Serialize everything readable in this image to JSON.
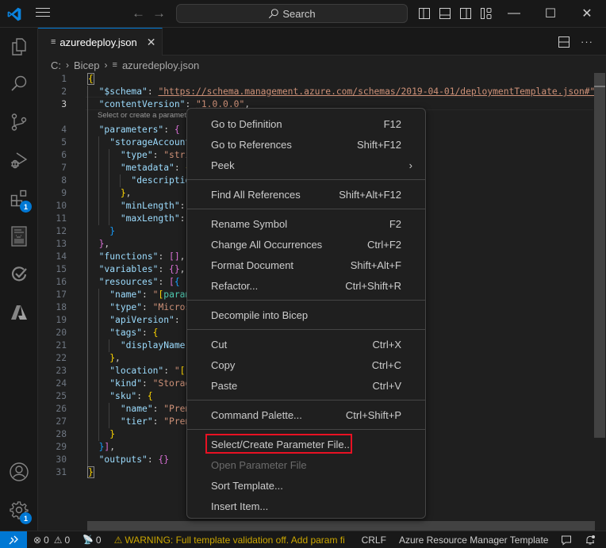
{
  "titlebar": {
    "search_label": "Search",
    "back": "←",
    "forward": "→",
    "minimize": "—",
    "maximize": "☐",
    "close": "✕"
  },
  "activity_bar": {
    "items": [
      {
        "name": "explorer",
        "icon": "files-icon"
      },
      {
        "name": "search",
        "icon": "search-icon"
      },
      {
        "name": "source-control",
        "icon": "source-control-icon"
      },
      {
        "name": "run-debug",
        "icon": "run-debug-icon"
      },
      {
        "name": "extensions",
        "icon": "extensions-icon",
        "badge": "1"
      },
      {
        "name": "document-outline",
        "icon": "document-icon"
      },
      {
        "name": "testing",
        "icon": "testing-icon"
      },
      {
        "name": "azure",
        "icon": "azure-icon"
      }
    ],
    "bottom": [
      {
        "name": "accounts",
        "icon": "account-icon"
      },
      {
        "name": "manage",
        "icon": "gear-icon",
        "badge": "1"
      }
    ]
  },
  "tab": {
    "label": "azuredeploy.json",
    "close": "✕",
    "file_icon": "≡"
  },
  "tab_actions": {
    "more": "···"
  },
  "breadcrumb": {
    "items": [
      "C:",
      "Bicep",
      "azuredeploy.json"
    ],
    "sep": "›"
  },
  "editor": {
    "codelens": "Select or create a parameter file to enable full validation...",
    "lines": [
      {
        "n": "1"
      },
      {
        "n": "2"
      },
      {
        "n": "3"
      },
      {
        "n": "4"
      },
      {
        "n": "5"
      },
      {
        "n": "6"
      },
      {
        "n": "7"
      },
      {
        "n": "8"
      },
      {
        "n": "9"
      },
      {
        "n": "10"
      },
      {
        "n": "11"
      },
      {
        "n": "12"
      },
      {
        "n": "13"
      },
      {
        "n": "14"
      },
      {
        "n": "15"
      },
      {
        "n": "16"
      },
      {
        "n": "17"
      },
      {
        "n": "18"
      },
      {
        "n": "19"
      },
      {
        "n": "20"
      },
      {
        "n": "21"
      },
      {
        "n": "22"
      },
      {
        "n": "23"
      },
      {
        "n": "24"
      },
      {
        "n": "25"
      },
      {
        "n": "26"
      },
      {
        "n": "27"
      },
      {
        "n": "28"
      },
      {
        "n": "29"
      },
      {
        "n": "30"
      },
      {
        "n": "31"
      }
    ],
    "code": {
      "schema_key": "\"$schema\"",
      "schema_val": "\"https://schema.management.azure.com/schemas/2019-04-01/deploymentTemplate.json#\"",
      "contentVersion_key": "\"contentVersion\"",
      "contentVersion_val": "\"1.0.0.0\"",
      "parameters_key": "\"parameters\"",
      "storageAccount_key": "\"storageAccount",
      "type_key": "\"type\"",
      "type_val": "\"stri",
      "metadata_key": "\"metadata\"",
      "description_key": "\"descriptio",
      "minLength_key": "\"minLength\"",
      "maxLength_key": "\"maxLength\"",
      "functions_key": "\"functions\"",
      "variables_key": "\"variables\"",
      "resources_key": "\"resources\"",
      "name_key": "\"name\"",
      "name_val_q": "\"",
      "name_val_expr": "param",
      "res_type_val": "\"Micros",
      "apiVersion_key": "\"apiVersion\"",
      "apiVersion_val": "\"",
      "tags_key": "\"tags\"",
      "displayName_key": "\"displayName\"",
      "location_key": "\"location\"",
      "location_val_q": "\"",
      "location_val_expr": "r",
      "kind_key": "\"kind\"",
      "kind_val": "\"Storag",
      "sku_key": "\"sku\"",
      "sku_name_val": "\"Prem",
      "tier_key": "\"tier\"",
      "tier_val": "\"Prem",
      "outputs_key": "\"outputs\""
    }
  },
  "context_menu": {
    "groups": [
      [
        {
          "label": "Go to Definition",
          "key": "F12"
        },
        {
          "label": "Go to References",
          "key": "Shift+F12"
        },
        {
          "label": "Peek",
          "key": "",
          "submenu": "›"
        }
      ],
      [
        {
          "label": "Find All References",
          "key": "Shift+Alt+F12"
        }
      ],
      [
        {
          "label": "Rename Symbol",
          "key": "F2"
        },
        {
          "label": "Change All Occurrences",
          "key": "Ctrl+F2"
        },
        {
          "label": "Format Document",
          "key": "Shift+Alt+F"
        },
        {
          "label": "Refactor...",
          "key": "Ctrl+Shift+R"
        }
      ],
      [
        {
          "label": "Decompile into Bicep",
          "key": ""
        }
      ],
      [
        {
          "label": "Cut",
          "key": "Ctrl+X"
        },
        {
          "label": "Copy",
          "key": "Ctrl+C"
        },
        {
          "label": "Paste",
          "key": "Ctrl+V"
        }
      ],
      [
        {
          "label": "Command Palette...",
          "key": "Ctrl+Shift+P"
        }
      ],
      [
        {
          "label": "Select/Create Parameter File...",
          "key": "",
          "highlighted": true
        },
        {
          "label": "Open Parameter File",
          "key": "",
          "disabled": true
        },
        {
          "label": "Sort Template...",
          "key": ""
        },
        {
          "label": "Insert Item...",
          "key": ""
        }
      ]
    ],
    "highlight_color": "#e81123"
  },
  "statusbar": {
    "remote_icon": "remote-icon",
    "errors": "0",
    "warnings": "0",
    "ports": "0",
    "warning_message": "WARNING: Full template validation off. Add param fi",
    "eol": "CRLF",
    "language": "Azure Resource Manager Template"
  },
  "colors": {
    "accent": "#0078d4",
    "warning": "#cca700",
    "background": "#1f1f1f"
  }
}
